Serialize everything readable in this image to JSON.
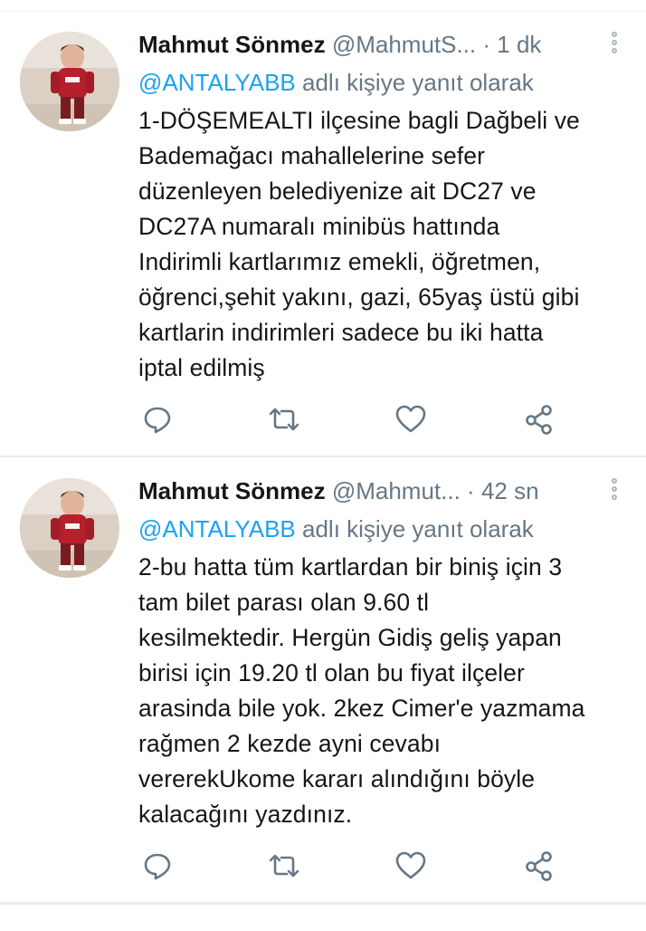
{
  "tweets": [
    {
      "name": "Mahmut Sönmez",
      "handle": "@MahmutS...",
      "separator": "·",
      "time": "1 dk",
      "reply_mention": "@ANTALYABB",
      "reply_suffix": " adlı kişiye yanıt olarak",
      "text": "1-DÖŞEMEALTI ilçesine bagli Dağbeli ve\nBademağacı mahallelerine sefer\ndüzenleyen belediyenize ait DC27 ve\nDC27A numaralı minibüs hattında\nIndirimli kartlarımız emekli, öğretmen,\nöğrenci,şehit yakını, gazi, 65yaş üstü gibi\nkartlarin indirimleri  sadece bu iki hatta\niptal edilmiş",
      "icons": [
        "reply-icon",
        "retweet-icon",
        "like-icon",
        "share-icon"
      ]
    },
    {
      "name": "Mahmut Sönmez",
      "handle": "@Mahmut...",
      "separator": "·",
      "time": "42 sn",
      "reply_mention": "@ANTALYABB",
      "reply_suffix": " adlı kişiye yanıt olarak",
      "text": "2-bu hatta tüm kartlardan bir biniş için 3\ntam bilet parası olan 9.60 tl\nkesilmektedir. Hergün Gidiş geliş yapan\nbirisi için 19.20 tl olan bu fiyat ilçeler\narasinda bile yok. 2kez Cimer'e yazmama\nrağmen 2 kezde ayni cevabı\nvererekUkome kararı alındığını böyle\nkalacağını yazdınız.",
      "icons": [
        "reply-icon",
        "retweet-icon",
        "like-icon",
        "share-icon"
      ]
    }
  ],
  "colors": {
    "accent": "#1da1f2",
    "secondary_text": "#657786",
    "primary_text": "#14171a",
    "icon": "#657786",
    "divider": "#e6ecf0"
  }
}
